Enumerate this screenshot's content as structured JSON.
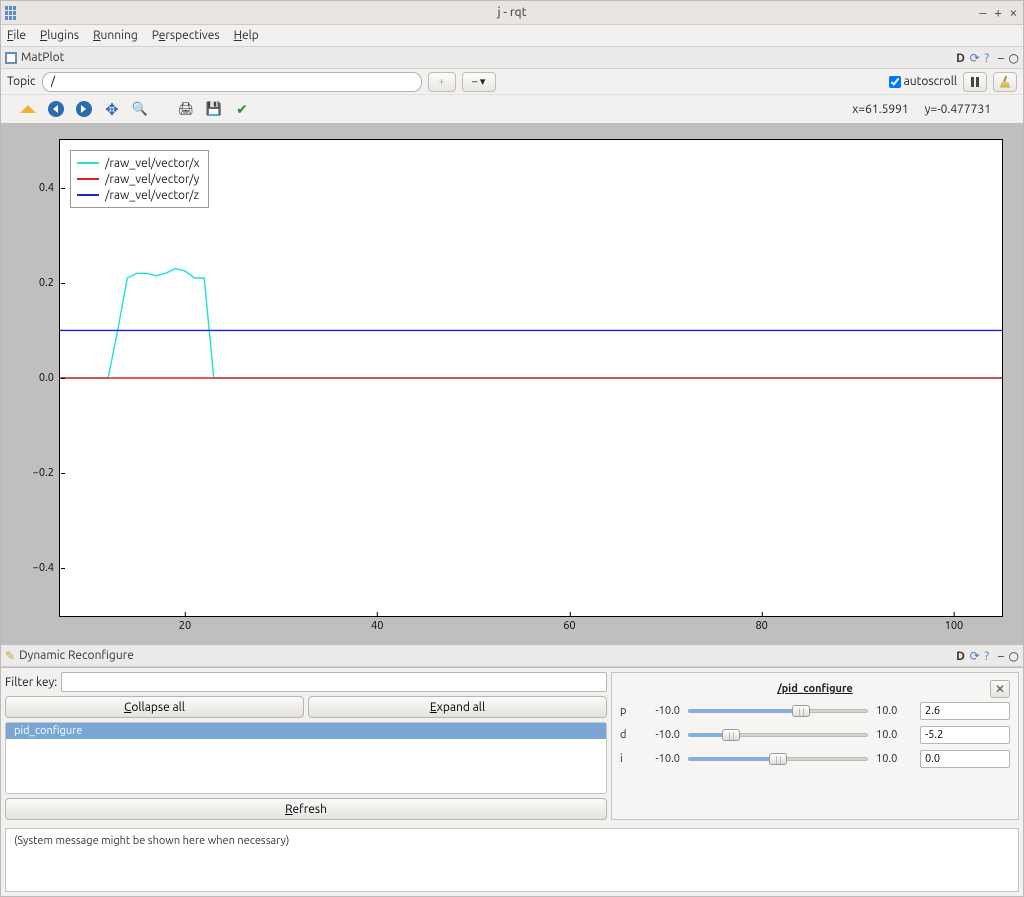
{
  "window": {
    "title": "j - rqt"
  },
  "menubar": {
    "file": "File",
    "plugins": "Plugins",
    "running": "Running",
    "perspectives": "Perspectives",
    "help": "Help"
  },
  "matplot": {
    "panel_title": "MatPlot",
    "topic_label": "Topic",
    "topic_value": "/",
    "autoscroll_label": "autoscroll",
    "autoscroll_checked": true,
    "coord_x": "x=61.5991",
    "coord_y": "y=-0.477731"
  },
  "chart_data": {
    "type": "line",
    "title": "",
    "xlabel": "",
    "ylabel": "",
    "xlim": [
      7,
      105
    ],
    "ylim": [
      -0.5,
      0.5
    ],
    "x_ticks": [
      20,
      40,
      60,
      80,
      100
    ],
    "y_ticks": [
      -0.4,
      -0.2,
      0.0,
      0.2,
      0.4
    ],
    "series": [
      {
        "name": "/raw_vel/vector/x",
        "color": "#20e0e0",
        "points": [
          [
            7,
            0
          ],
          [
            12,
            0
          ],
          [
            13,
            0.1
          ],
          [
            14,
            0.21
          ],
          [
            15,
            0.22
          ],
          [
            16,
            0.22
          ],
          [
            17,
            0.215
          ],
          [
            18,
            0.22
          ],
          [
            19,
            0.23
          ],
          [
            20,
            0.225
          ],
          [
            21,
            0.21
          ],
          [
            22,
            0.21
          ],
          [
            23,
            0.0
          ],
          [
            24,
            0.0
          ],
          [
            105,
            0.0
          ]
        ]
      },
      {
        "name": "/raw_vel/vector/y",
        "color": "#e02020",
        "points": [
          [
            7,
            0
          ],
          [
            105,
            0
          ]
        ]
      },
      {
        "name": "/raw_vel/vector/z",
        "color": "#2020d0",
        "points": [
          [
            7,
            0.1
          ],
          [
            105,
            0.1
          ]
        ]
      }
    ]
  },
  "dynrec": {
    "panel_title": "Dynamic Reconfigure",
    "filter_label": "Filter key:",
    "filter_value": "",
    "collapse": "Collapse all",
    "expand": "Expand all",
    "tree_item": "pid_configure",
    "refresh": "Refresh",
    "selected_title": "/pid_configure",
    "params": [
      {
        "key": "p",
        "lo": "-10.0",
        "hi": "10.0",
        "value": "2.6",
        "frac": 0.63
      },
      {
        "key": "d",
        "lo": "-10.0",
        "hi": "10.0",
        "value": "-5.2",
        "frac": 0.24
      },
      {
        "key": "i",
        "lo": "-10.0",
        "hi": "10.0",
        "value": "0.0",
        "frac": 0.5
      }
    ],
    "sysmsg": "(System message might be shown here when necessary)"
  }
}
